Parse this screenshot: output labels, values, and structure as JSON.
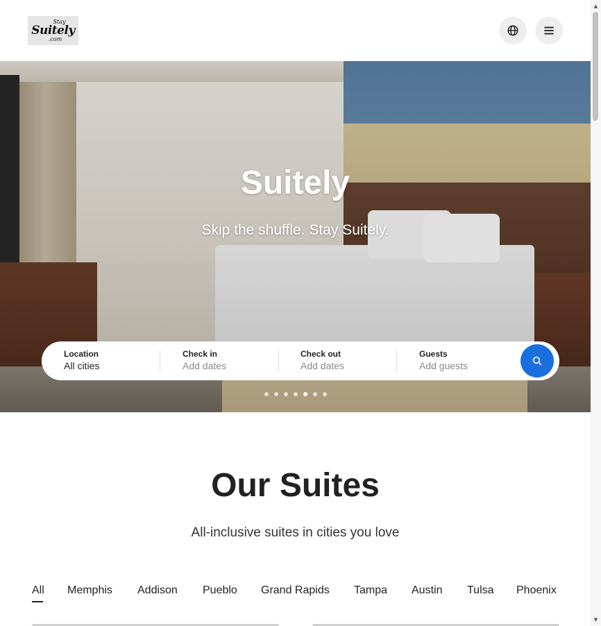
{
  "header": {
    "logo": {
      "line1": "Stay",
      "line2": "Suitely",
      "line3": ".com"
    },
    "globe_icon": "globe-icon",
    "menu_icon": "hamburger-menu-icon"
  },
  "hero": {
    "title": "Suitely",
    "subtitle": "Skip the shuffle. Stay Suitely.",
    "carousel": {
      "total": 7,
      "active_index": 4
    }
  },
  "search": {
    "location": {
      "label": "Location",
      "value": "All cities"
    },
    "check_in": {
      "label": "Check in",
      "placeholder": "Add dates"
    },
    "check_out": {
      "label": "Check out",
      "placeholder": "Add dates"
    },
    "guests": {
      "label": "Guests",
      "placeholder": "Add guests"
    },
    "button_icon": "search-icon",
    "accent_color": "#1a6fe0"
  },
  "suites": {
    "title": "Our Suites",
    "subtitle": "All-inclusive suites in cities you love",
    "tabs": [
      "All",
      "Memphis",
      "Addison",
      "Pueblo",
      "Grand Rapids",
      "Tampa",
      "Austin",
      "Tulsa",
      "Phoenix"
    ],
    "active_tab": "All"
  }
}
